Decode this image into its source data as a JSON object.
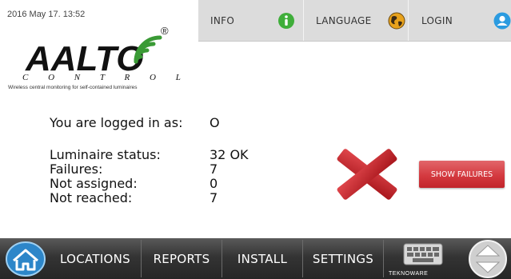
{
  "header": {
    "datetime": "2016 May 17. 13:52",
    "logo_text": "AALTO",
    "logo_sub": "C O N T R O L",
    "registered": "®",
    "tagline": "Wireless central monitoring for self-contained luminaires"
  },
  "topnav": {
    "info": "INFO",
    "language": "LANGUAGE",
    "login": "LOGIN"
  },
  "status": {
    "logged_label": "You are logged in as:",
    "logged_value": "O",
    "rows": [
      {
        "label": "Luminaire status:",
        "value": "32 OK"
      },
      {
        "label": "Failures:",
        "value": "7"
      },
      {
        "label": "Not assigned:",
        "value": "0"
      },
      {
        "label": "Not reached:",
        "value": "7"
      }
    ],
    "show_failures": "SHOW FAILURES"
  },
  "bottom": {
    "locations": "LOCATIONS",
    "reports": "REPORTS",
    "install": "INSTALL",
    "settings": "SETTINGS",
    "brand": "TEKNOWARE"
  },
  "icons": {
    "home": "home-icon",
    "info": "info-icon",
    "language": "globe-icon",
    "login": "user-icon",
    "fail": "red-x-icon",
    "keyboard": "keyboard-icon",
    "scroll": "up-down-arrows-icon"
  },
  "colors": {
    "fail_red": "#d43a40",
    "info_green": "#3fae3a",
    "login_blue": "#2b9be0",
    "bar_dark": "#2e2e2e"
  }
}
